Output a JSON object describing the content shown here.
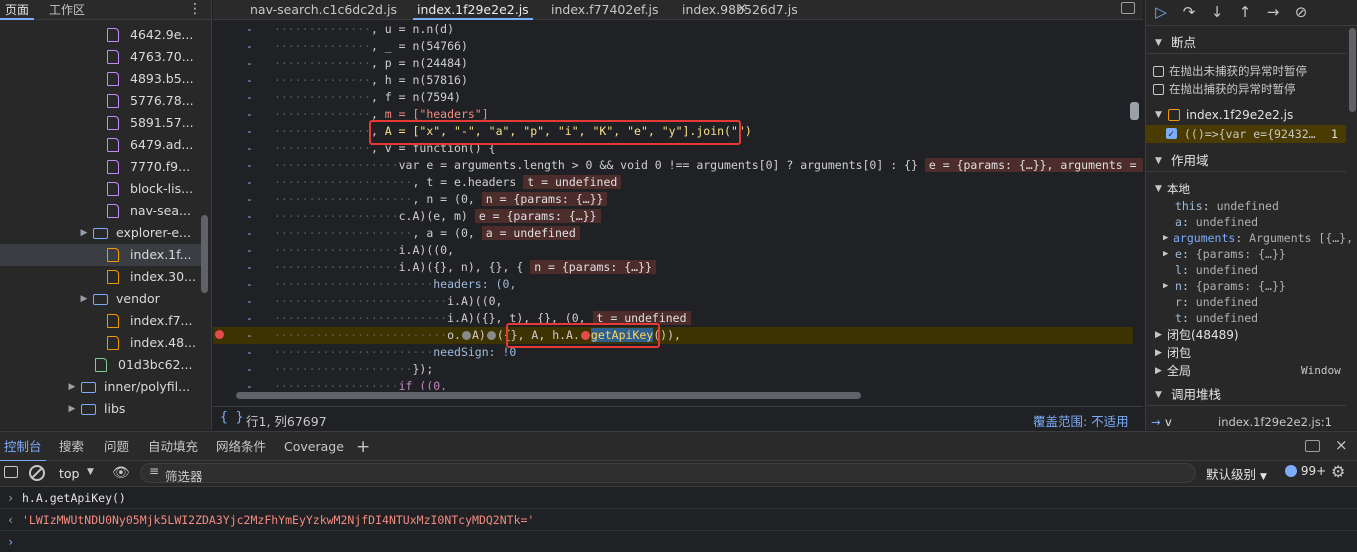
{
  "navigator": {
    "tabs": [
      "页面",
      "工作区"
    ],
    "more_label": "⋮",
    "tree": [
      {
        "label": "4642.9e...",
        "kind": "file"
      },
      {
        "label": "4763.70...",
        "kind": "file"
      },
      {
        "label": "4893.b5...",
        "kind": "file"
      },
      {
        "label": "5776.78...",
        "kind": "file"
      },
      {
        "label": "5891.57...",
        "kind": "file"
      },
      {
        "label": "6479.ad...",
        "kind": "file"
      },
      {
        "label": "7770.f9...",
        "kind": "file"
      },
      {
        "label": "block-lis...",
        "kind": "file"
      },
      {
        "label": "nav-sea...",
        "kind": "file"
      },
      {
        "label": "explorer-e...",
        "kind": "folder"
      },
      {
        "label": "index.1f...",
        "kind": "file-js",
        "selected": true
      },
      {
        "label": "index.30...",
        "kind": "file-js"
      },
      {
        "label": "vendor",
        "kind": "folder"
      },
      {
        "label": "index.f7...",
        "kind": "file-js"
      },
      {
        "label": "index.48...",
        "kind": "file-js"
      },
      {
        "label": "01d3bc62...",
        "kind": "file-green"
      },
      {
        "label": "inner/polyfil...",
        "kind": "folder"
      },
      {
        "label": "libs",
        "kind": "folder"
      }
    ]
  },
  "editor": {
    "tabs": [
      {
        "label": "nav-search.c1c6dc2d.js",
        "active": false
      },
      {
        "label": "index.1f29e2e2.js",
        "active": true
      },
      {
        "label": "index.f77402ef.js",
        "active": false
      },
      {
        "label": "index.98b526d7.js",
        "active": false
      }
    ],
    "close_icon": "×",
    "code_lines": [
      "u = n.n(d)",
      "_ = n(54766)",
      "p = n(24484)",
      "h = n(57816)",
      "f = n(7594)",
      "m = [\"headers\"]",
      "A = [\"x\", \"-\", \"a\", \"p\", \"i\", \"K\", \"e\", \"y\"].join(\"\")",
      "v = function() {",
      "var e = arguments.length > 0 && void 0 !== arguments[0] ? arguments[0] : {}",
      ", t = e.headers",
      ", n = (0,",
      "c.A)(e, m)",
      ", a = (0,",
      "i.A)((0,",
      "i.A)({}, n), {}, {",
      "headers: (0,",
      "i.A)((0,",
      "i.A)({}, t), {}, (0,",
      "o.A)({}, A, h.A.getApiKey())),",
      "needSign: !0",
      "});",
      "if ((0,"
    ],
    "inline_values": {
      "line9": "e = {params: {…}}, arguments = Argum",
      "line10": "t = undefined",
      "line11": "n = {params: {…}}",
      "line12": "e = {params: {…}}",
      "line13": "a = undefined",
      "line15": "n = {params: {…}}",
      "line18": "t = undefined"
    },
    "status": {
      "braces": "{ }",
      "position": "行1, 列67697",
      "coverage": "覆盖范围: 不适用"
    }
  },
  "debugger": {
    "toolbar_icons": [
      "resume-icon",
      "step-over-icon",
      "step-into-icon",
      "step-out-icon",
      "step-icon",
      "deactivate-breakpoints-icon"
    ],
    "breakpoints_title": "断点",
    "pause_uncaught": "在抛出未捕获的异常时暂停",
    "pause_caught": "在抛出捕获的异常时暂停",
    "bp_file": "index.1f29e2e2.js",
    "bp_entry": "(()=>{var e={92432…",
    "bp_line": "1",
    "scope_title": "作用域",
    "local_title": "本地",
    "scope_vars": [
      {
        "key": "this",
        "val": "undefined"
      },
      {
        "key": "a",
        "val": "undefined"
      },
      {
        "key": "arguments",
        "val": "Arguments [{…},"
      },
      {
        "key": "e",
        "val": "{params: {…}}"
      },
      {
        "key": "l",
        "val": "undefined"
      },
      {
        "key": "n",
        "val": "{params: {…}}"
      },
      {
        "key": "r",
        "val": "undefined"
      },
      {
        "key": "t",
        "val": "undefined"
      }
    ],
    "closure": "闭包(48489)",
    "closure2": "闭包",
    "global": "全局",
    "global_val": "Window",
    "callstack_title": "调用堆栈",
    "callstack_fn": "v",
    "callstack_loc": "index.1f29e2e2.js:1"
  },
  "drawer": {
    "tabs": [
      "控制台",
      "搜索",
      "问题",
      "自动填充",
      "网络条件",
      "Coverage"
    ],
    "add_label": "+",
    "context": "top",
    "filter_placeholder": "筛选器",
    "level": "默认级别",
    "issues_count": "99+",
    "console_input": "h.A.getApiKey()",
    "console_output": "'LWIzMWUtNDU0Ny05Mjk5LWI2ZDA3Yjc2MzFhYmEyYzkwM2NjfDI4NTUxMzI0NTcyMDQ2NTk='"
  },
  "colors": {
    "accent": "#7cacf8",
    "annotation_box": "#e53935",
    "breakpoint": "#e44c4c",
    "paused_line": "#3c3300",
    "console_string": "#f28b82"
  }
}
